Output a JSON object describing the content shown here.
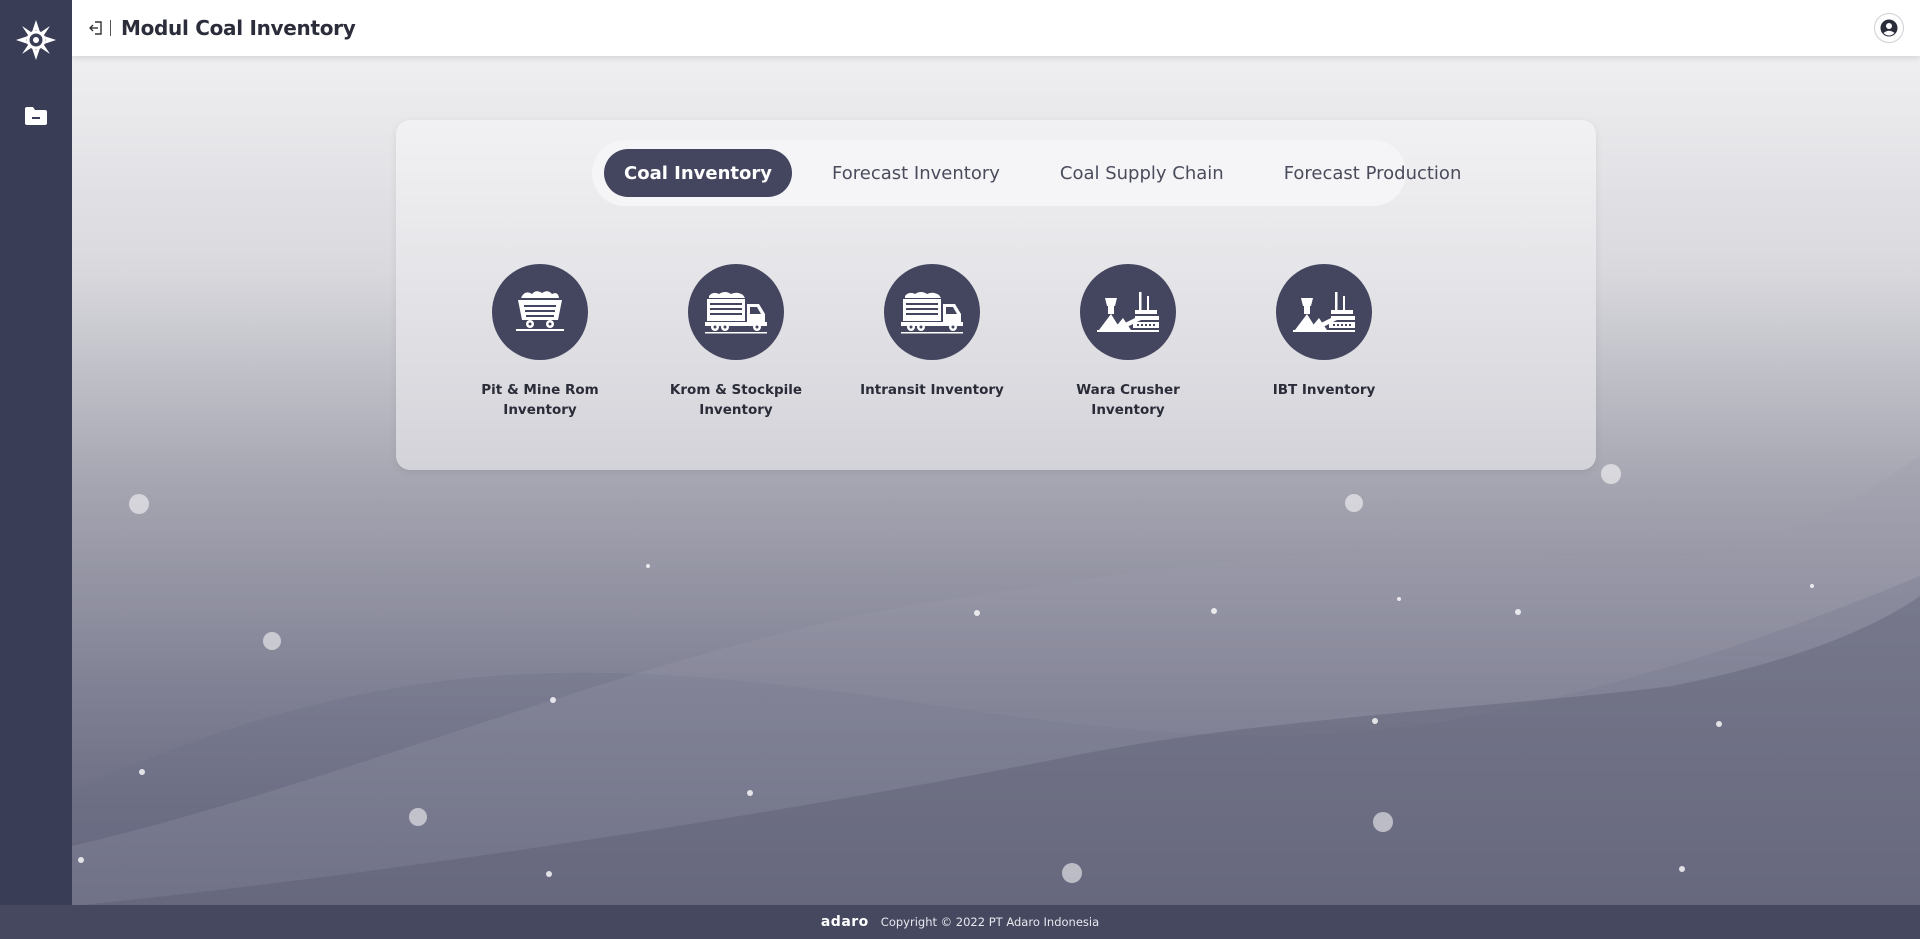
{
  "header": {
    "title": "Modul Coal Inventory"
  },
  "sidebar": {
    "items": [
      {
        "icon": "folder-icon"
      }
    ]
  },
  "tabs": [
    {
      "label": "Coal Inventory",
      "active": true
    },
    {
      "label": "Forecast Inventory",
      "active": false
    },
    {
      "label": "Coal Supply Chain",
      "active": false
    },
    {
      "label": "Forecast Production",
      "active": false
    }
  ],
  "modules": [
    {
      "label": "Pit & Mine Rom Inventory",
      "icon": "mine-cart-icon"
    },
    {
      "label": "Krom & Stockpile Inventory",
      "icon": "dump-truck-icon"
    },
    {
      "label": "Intransit Inventory",
      "icon": "dump-truck-icon"
    },
    {
      "label": "Wara Crusher Inventory",
      "icon": "crusher-plant-icon"
    },
    {
      "label": "IBT Inventory",
      "icon": "crusher-plant-icon"
    }
  ],
  "footer": {
    "brand": "adaro",
    "copyright": "Copyright © 2022 PT Adaro Indonesia"
  },
  "colors": {
    "sidebar": "#3a3d56",
    "accent": "#44465f",
    "footer": "#464860"
  }
}
